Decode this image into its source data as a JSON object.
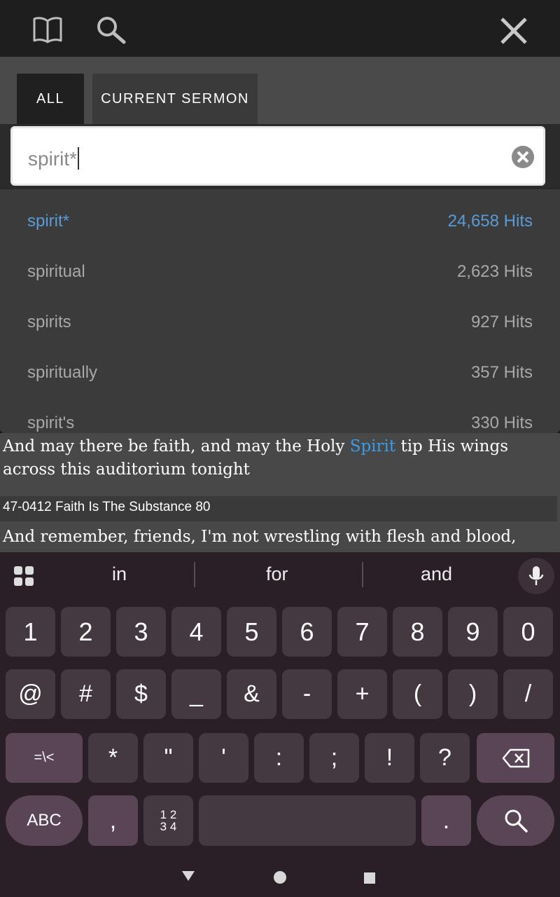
{
  "toolbar": {
    "book_icon": "book-icon",
    "search_icon": "search-icon",
    "close_icon": "close-icon"
  },
  "tabs": [
    {
      "label": "ALL",
      "active": true
    },
    {
      "label": "CURRENT SERMON",
      "active": false
    }
  ],
  "search": {
    "value": "spirit*"
  },
  "suggestions": [
    {
      "word": "spirit*",
      "hits": "24,658 Hits",
      "active": true
    },
    {
      "word": "spiritual",
      "hits": "2,623 Hits"
    },
    {
      "word": "spirits",
      "hits": "927 Hits"
    },
    {
      "word": "spiritually",
      "hits": "357 Hits"
    },
    {
      "word": "spirit's",
      "hits": "330 Hits"
    }
  ],
  "results": {
    "para1_before": "And may there be faith, and may the Holy ",
    "para1_highlight": "Spirit",
    "para1_after": " tip His wings across this auditorium tonight",
    "reference": "47-0412 Faith Is The Substance 80",
    "para2": "And remember, friends, I'm not wrestling with flesh and blood,"
  },
  "keyboard": {
    "suggestions": [
      "in",
      "for",
      "and"
    ],
    "row1": [
      "1",
      "2",
      "3",
      "4",
      "5",
      "6",
      "7",
      "8",
      "9",
      "0"
    ],
    "row2": [
      "@",
      "#",
      "$",
      "_",
      "&",
      "-",
      "+",
      "(",
      ")",
      "/"
    ],
    "row3": [
      "=\\<",
      "*",
      "\"",
      "'",
      ":",
      ";",
      "!",
      "?"
    ],
    "row4": {
      "abc": "ABC",
      "comma": ",",
      "numpad_top": "1 2",
      "numpad_bottom": "3 4",
      "period": "."
    }
  },
  "colors": {
    "accent": "#5b9bd5",
    "highlight": "#3b9ce8",
    "keyboard_bg": "#2a1f26",
    "key_bg": "#443940",
    "key_accent": "#5a4556"
  }
}
